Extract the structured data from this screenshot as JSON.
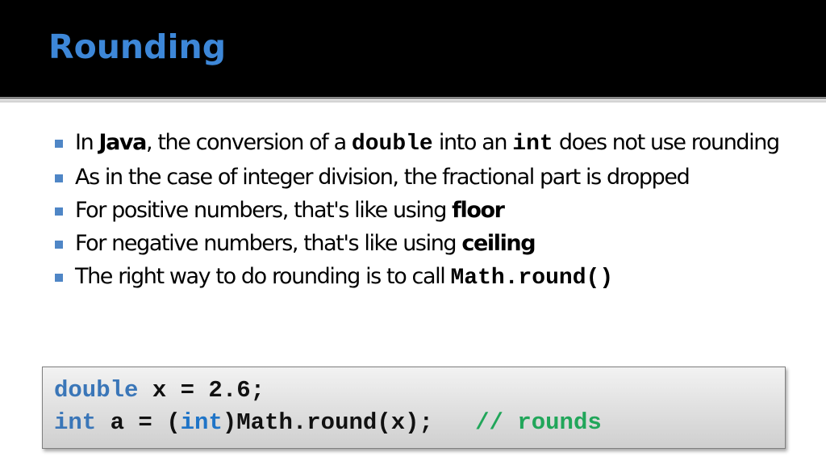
{
  "slide": {
    "title": "Rounding",
    "colors": {
      "title": "#3d87d8",
      "header_bg": "#000000",
      "bullet": "#4f86c6",
      "keyword": "#3a76b8",
      "comment": "#21a65a"
    },
    "bullets": [
      {
        "parts": [
          "In ",
          "Java",
          ", the conversion of a ",
          "double",
          " into an ",
          "int",
          " does not use rounding"
        ]
      },
      {
        "text": "As in the case of integer division, the fractional part is dropped"
      },
      {
        "text": "For positive numbers, that's like using ",
        "bold": "floor"
      },
      {
        "text": "For negative numbers, that's like using ",
        "bold": "ceiling"
      },
      {
        "text": "The right way to do rounding is to call ",
        "code": "Math.round()"
      }
    ],
    "code": {
      "line1": {
        "keyword": "double",
        "rest": " x = 2.6;"
      },
      "line2": {
        "keyword": "int",
        "part1": " a = (",
        "cast_keyword": "int",
        "part2": ")Math.round(x);   ",
        "comment": "// rounds"
      }
    }
  }
}
